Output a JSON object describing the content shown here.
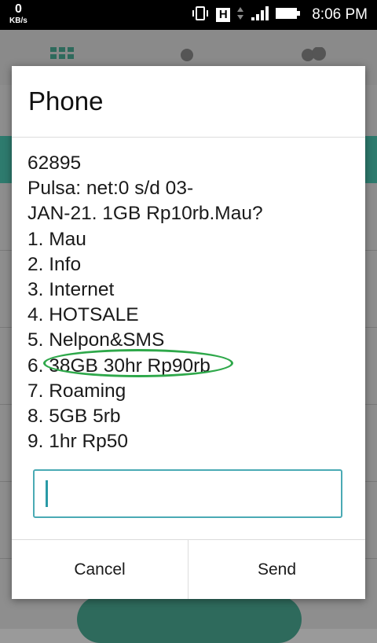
{
  "status_bar": {
    "speed_value": "0",
    "speed_unit": "KB/s",
    "network_type": "H",
    "time": "8:06 PM"
  },
  "dialog": {
    "title": "Phone",
    "message_lines": [
      "62895",
      "Pulsa:              net:0 s/d 03-",
      "JAN-21. 1GB Rp10rb.Mau?",
      "1. Mau",
      "2. Info",
      "3. Internet",
      "4. HOTSALE",
      "5. Nelpon&SMS",
      "6. 38GB 30hr Rp90rb",
      "7. Roaming",
      "8. 5GB 5rb",
      "9. 1hr Rp50"
    ],
    "input_value": "",
    "buttons": {
      "cancel": "Cancel",
      "send": "Send"
    }
  },
  "colors": {
    "highlight_ring": "#2ea84a",
    "input_border": "#4aaab4",
    "background_accent": "#2e7b6e"
  }
}
